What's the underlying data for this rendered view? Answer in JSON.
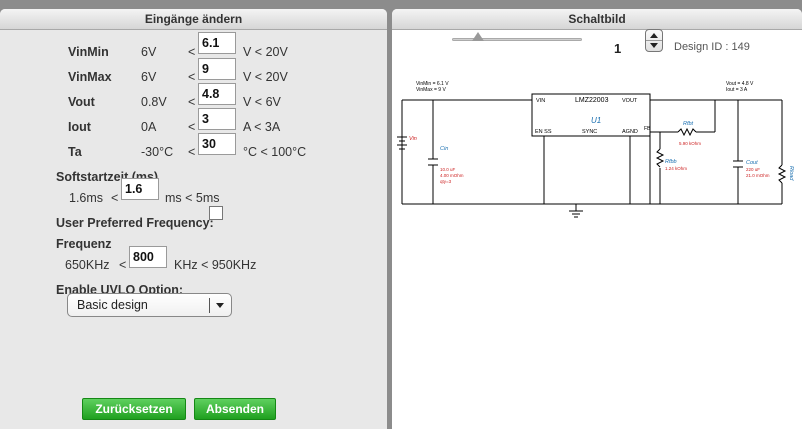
{
  "left_panel": {
    "title": "Eingänge ändern",
    "rows": [
      {
        "label": "VinMin",
        "default": "6V",
        "op": "<",
        "value": "6.1",
        "limit": "V < 20V"
      },
      {
        "label": "VinMax",
        "default": "6V",
        "op": "<",
        "value": "9",
        "limit": "V < 20V"
      },
      {
        "label": "Vout",
        "default": "0.8V",
        "op": "<",
        "value": "4.8",
        "limit": "V < 6V"
      },
      {
        "label": "Iout",
        "default": "0A",
        "op": "<",
        "value": "3",
        "limit": "A < 3A"
      },
      {
        "label": "Ta",
        "default": "-30°C",
        "op": "<",
        "value": "30",
        "limit": "°C < 100°C"
      }
    ],
    "softstart": {
      "label": "Softstartzeit (ms)",
      "min": "1.6ms",
      "op": "<",
      "value": "1.6",
      "limit": "ms < 5ms"
    },
    "user_freq_label": "User Preferred Frequency:",
    "frequency": {
      "label": "Frequenz",
      "min": "650KHz",
      "op": "<",
      "value": "800",
      "limit": "KHz < 950KHz"
    },
    "uvlo": {
      "label": "Enable UVLO Option:",
      "selected": "Basic design"
    },
    "buttons": {
      "reset": "Zurücksetzen",
      "submit": "Absenden"
    }
  },
  "right_panel": {
    "title": "Schaltbild",
    "page_number": "1",
    "design_id": "Design ID : 149"
  },
  "schematic": {
    "vin_info": [
      "VinMin = 6.1 V",
      "VinMax = 9 V"
    ],
    "vout_info": [
      "Vout = 4.8 V",
      "Iout = 3 A"
    ],
    "ic_name": "LMZ22003",
    "ic_ref": "U1",
    "pins": {
      "vin": "VIN",
      "vout": "VOUT",
      "en_ss": "EN SS",
      "sync": "SYNC",
      "agnd": "AGND",
      "fb": "FB"
    },
    "source_label": "Vin",
    "cin": {
      "name": "Cin",
      "value": "10.0 uF",
      "esr": "4.00 mOhm",
      "qty": "qty=3"
    },
    "rfbt": {
      "name": "Rfbt",
      "value": "5.90 kOhm"
    },
    "rfbb": {
      "name": "Rfbb",
      "value": "1.24 kOhm"
    },
    "cout": {
      "name": "Cout",
      "value": "220 uF",
      "esr": "21.0 mOhm"
    },
    "rload": {
      "name": "Rload"
    },
    "colors": {
      "designator": "#1a6fb0",
      "value": "#cc1f1f"
    }
  }
}
